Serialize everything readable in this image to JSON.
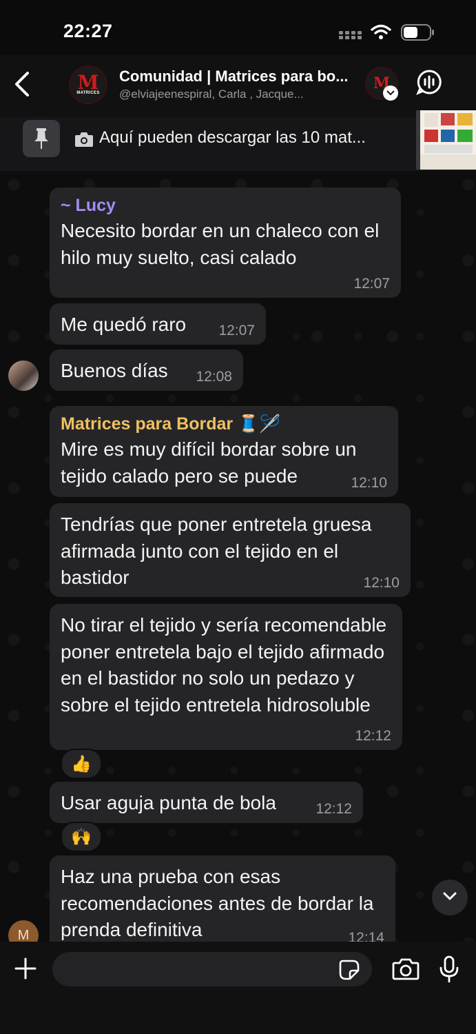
{
  "status_bar": {
    "time": "22:27"
  },
  "header": {
    "title": "Comunidad | Matrices para bo...",
    "subtitle": "@elviajeenespiral, Carla  , Jacque...",
    "logo_letter": "M",
    "logo_text": "MATRICES"
  },
  "pinned": {
    "text": "Aquí pueden descargar las 10 mat...",
    "icon": "camera-icon"
  },
  "messages": [
    {
      "sender": "~ Lucy",
      "text": "Necesito bordar en un chaleco con el hilo muy suelto, casi calado",
      "time": "12:07"
    },
    {
      "text": "Me quedó raro",
      "time": "12:07"
    },
    {
      "text": "Buenos días",
      "time": "12:08"
    },
    {
      "sender": "Matrices para Bordar 🧵🪡",
      "text": "Mire es muy difícil bordar sobre un tejido calado pero se puede",
      "time": "12:10"
    },
    {
      "text": "Tendrías que poner entretela gruesa afirmada junto con el tejido en el bastidor",
      "time": "12:10"
    },
    {
      "text": "No tirar el tejido y sería recomendable poner entretela bajo el tejido afirmado en el bastidor no solo un pedazo  y sobre el tejido entretela hidrosoluble",
      "time": "12:12",
      "reaction": "👍"
    },
    {
      "text": "Usar aguja punta de bola",
      "time": "12:12",
      "reaction": "🙌"
    },
    {
      "text": "Haz una prueba con esas recomendaciones antes de bordar la prenda definitiva",
      "time": "12:14"
    }
  ],
  "avatars": {
    "m_initial": "M"
  },
  "colors": {
    "lucy": "#a68bf5",
    "matrices": "#f0c060",
    "bubble": "#252528",
    "logo_red": "#d11a1a"
  }
}
